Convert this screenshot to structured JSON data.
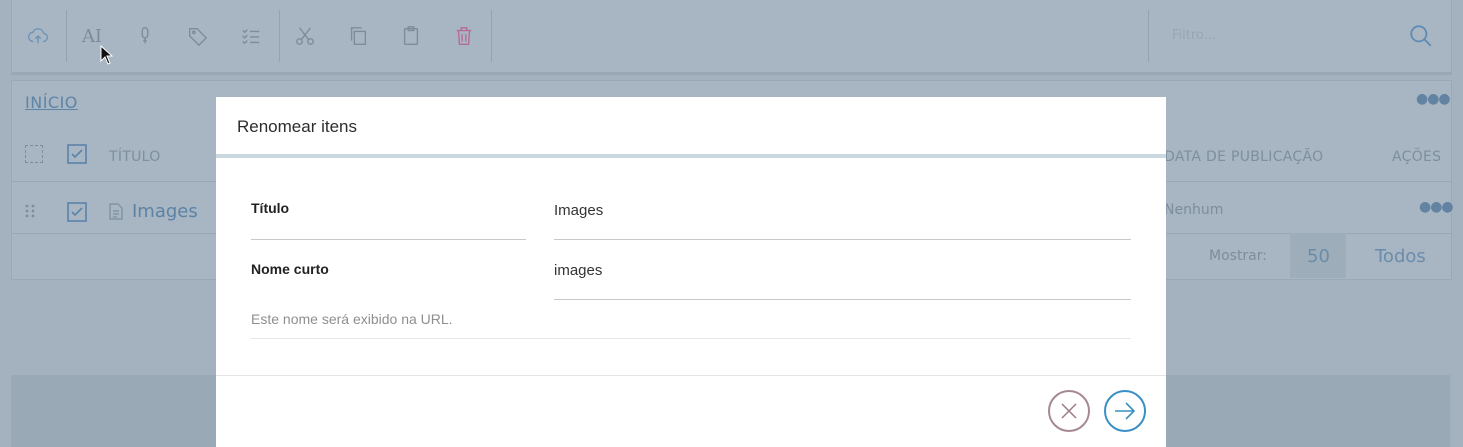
{
  "toolbar": {
    "buttons": [
      {
        "name": "upload-cloud-icon"
      },
      {
        "name": "ai-text-icon",
        "label": "AI"
      },
      {
        "name": "microphone-icon"
      },
      {
        "name": "tag-icon"
      },
      {
        "name": "checklist-icon"
      },
      {
        "name": "cut-icon"
      },
      {
        "name": "copy-icon"
      },
      {
        "name": "paste-icon"
      },
      {
        "name": "delete-icon"
      }
    ],
    "filter_placeholder": "Filtro..."
  },
  "breadcrumb": {
    "label": "INÍCIO"
  },
  "table": {
    "headers": {
      "title": "TÍTULO",
      "publish_date": "DATA DE PUBLICAÇÃO",
      "actions": "AÇÕES"
    },
    "rows": [
      {
        "title": "Images",
        "publish_date": "Nenhum"
      }
    ],
    "pagination": {
      "show_label": "Mostrar:",
      "option_50": "50",
      "option_all": "Todos"
    }
  },
  "modal": {
    "title": "Renomear itens",
    "fields": [
      {
        "label": "Título",
        "value": "Images"
      },
      {
        "label": "Nome curto",
        "value": "images"
      }
    ],
    "hint": "Este nome será exibido na URL."
  },
  "colors": {
    "overlay_bg": "#a3b2be",
    "accent_blue": "#3a8fc4",
    "cancel_circle": "#9b7c82",
    "delete_red": "#c0608a"
  }
}
